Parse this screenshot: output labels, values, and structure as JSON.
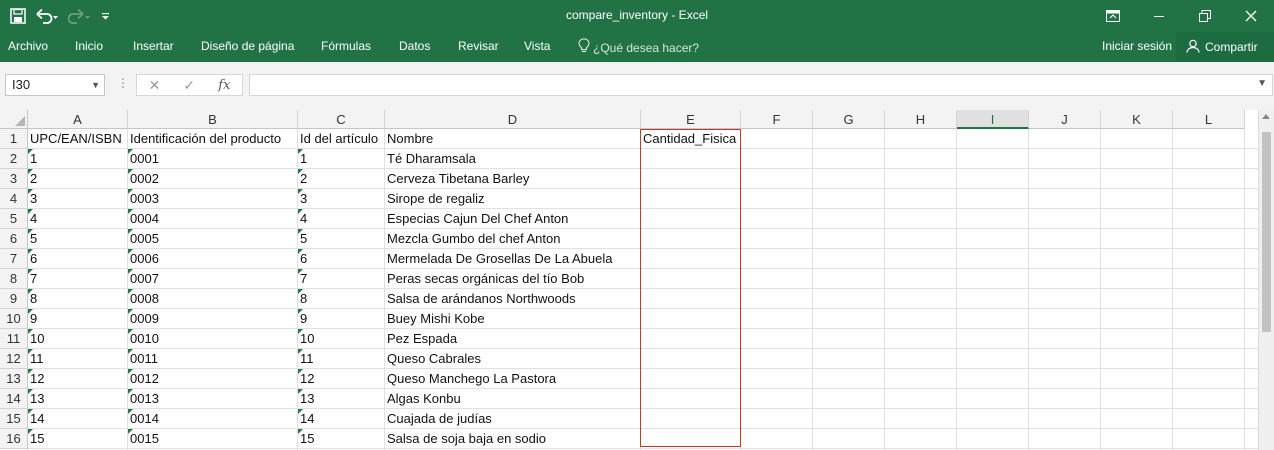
{
  "window": {
    "title": "compare_inventory - Excel"
  },
  "qat": {
    "save": "save-icon",
    "undo": "undo-icon",
    "redo": "redo-icon",
    "customize": "customize-icon"
  },
  "ribbon": {
    "tabs": [
      "Archivo",
      "Inicio",
      "Insertar",
      "Diseño de página",
      "Fórmulas",
      "Datos",
      "Revisar",
      "Vista"
    ],
    "tell_me": "¿Qué desea hacer?",
    "sign_in": "Iniciar sesión",
    "share": "Compartir"
  },
  "formula_bar": {
    "name_box": "I30",
    "formula": ""
  },
  "sheet": {
    "selected_column": "I",
    "columns": [
      "A",
      "B",
      "C",
      "D",
      "E",
      "F",
      "G",
      "H",
      "I",
      "J",
      "K",
      "L"
    ],
    "row_numbers": [
      "1",
      "2",
      "3",
      "4",
      "5",
      "6",
      "7",
      "8",
      "9",
      "10",
      "11",
      "12",
      "13",
      "14",
      "15",
      "16"
    ],
    "headers": [
      "UPC/EAN/ISBN",
      "Identificación del producto",
      "Id del artículo",
      "Nombre",
      "Cantidad_Fisica"
    ],
    "rows": [
      [
        "1",
        "0001",
        "1",
        "Té Dharamsala"
      ],
      [
        "2",
        "0002",
        "2",
        "Cerveza Tibetana Barley"
      ],
      [
        "3",
        "0003",
        "3",
        "Sirope de regaliz"
      ],
      [
        "4",
        "0004",
        "4",
        "Especias Cajun Del Chef Anton"
      ],
      [
        "5",
        "0005",
        "5",
        "Mezcla Gumbo del chef Anton"
      ],
      [
        "6",
        "0006",
        "6",
        "Mermelada De Grosellas De La Abuela"
      ],
      [
        "7",
        "0007",
        "7",
        "Peras secas orgánicas del tío Bob"
      ],
      [
        "8",
        "0008",
        "8",
        "Salsa de arándanos Northwoods"
      ],
      [
        "9",
        "0009",
        "9",
        "Buey Mishi Kobe"
      ],
      [
        "10",
        "0010",
        "10",
        "Pez Espada"
      ],
      [
        "11",
        "0011",
        "11",
        "Queso Cabrales"
      ],
      [
        "12",
        "0012",
        "12",
        "Queso Manchego La Pastora"
      ],
      [
        "13",
        "0013",
        "13",
        "Algas Konbu"
      ],
      [
        "14",
        "0014",
        "14",
        "Cuajada de judías"
      ],
      [
        "15",
        "0015",
        "15",
        "Salsa de soja baja en sodio"
      ]
    ]
  },
  "colors": {
    "accent": "#217346",
    "highlight_border": "#c0392b"
  }
}
